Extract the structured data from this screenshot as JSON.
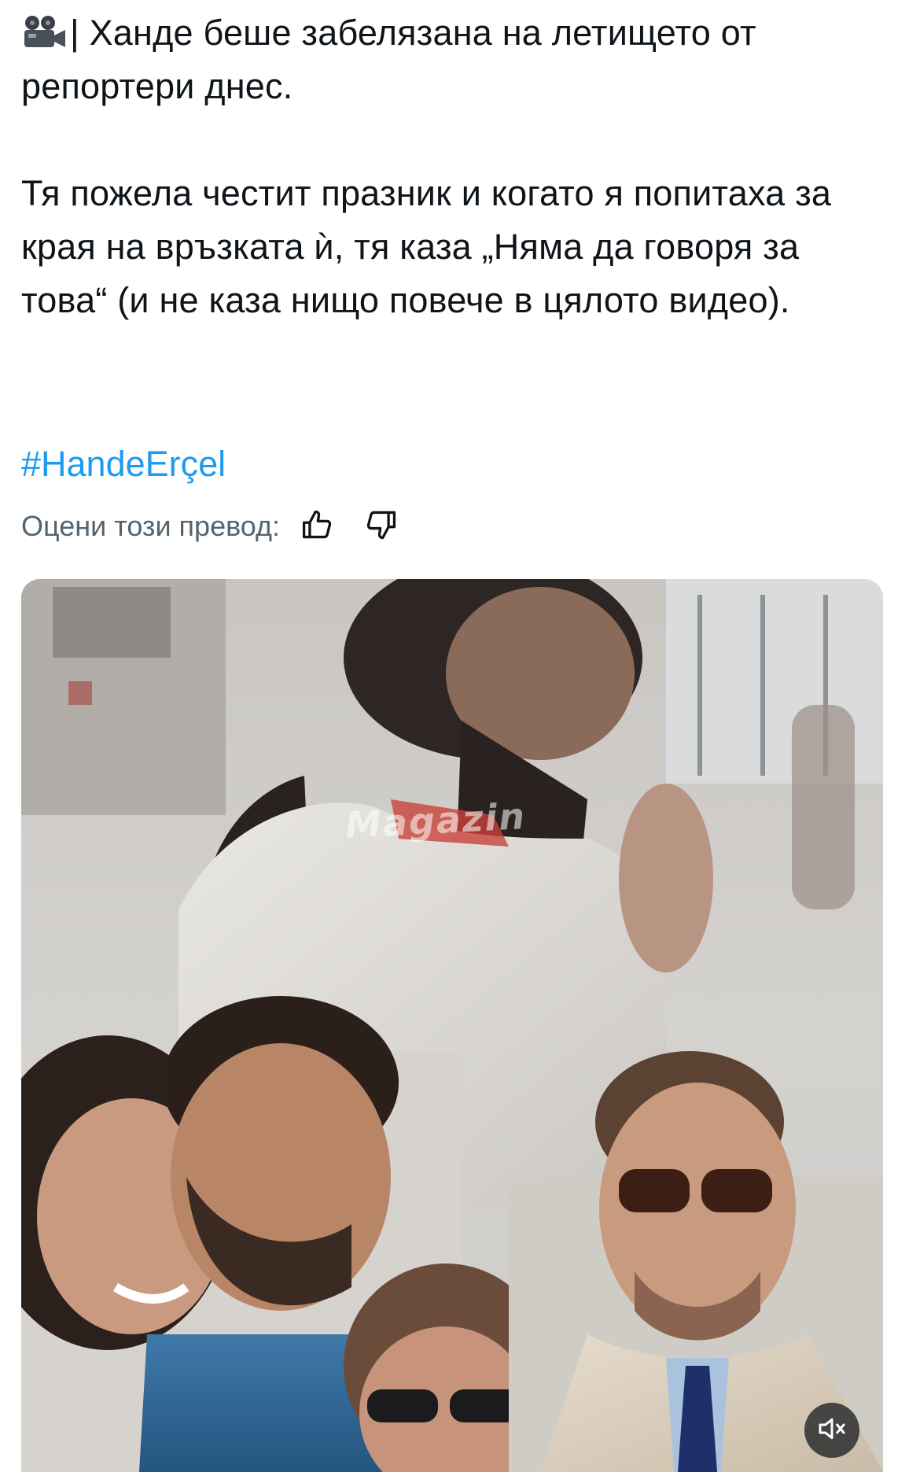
{
  "post": {
    "line1_text": "| Ханде беше забелязана на летището от репортери днес.",
    "paragraph2": "Тя пожела честит празник и когато я попитаха за края на връзката ѝ, тя каза „Няма да говоря за това“ (и не каза нищо повече в цялото видео).",
    "hashtag": "#HandeErçel",
    "emoji_icon": "movie-camera-icon"
  },
  "translation_rating": {
    "label": "Оцени този превод:",
    "like_icon": "thumbs-up-icon",
    "dislike_icon": "thumbs-down-icon"
  },
  "media": {
    "watermark": "Magazin",
    "mute_icon": "speaker-muted-icon"
  },
  "colors": {
    "text": "#0f1419",
    "link": "#1d9bf0",
    "secondary": "#536471"
  }
}
